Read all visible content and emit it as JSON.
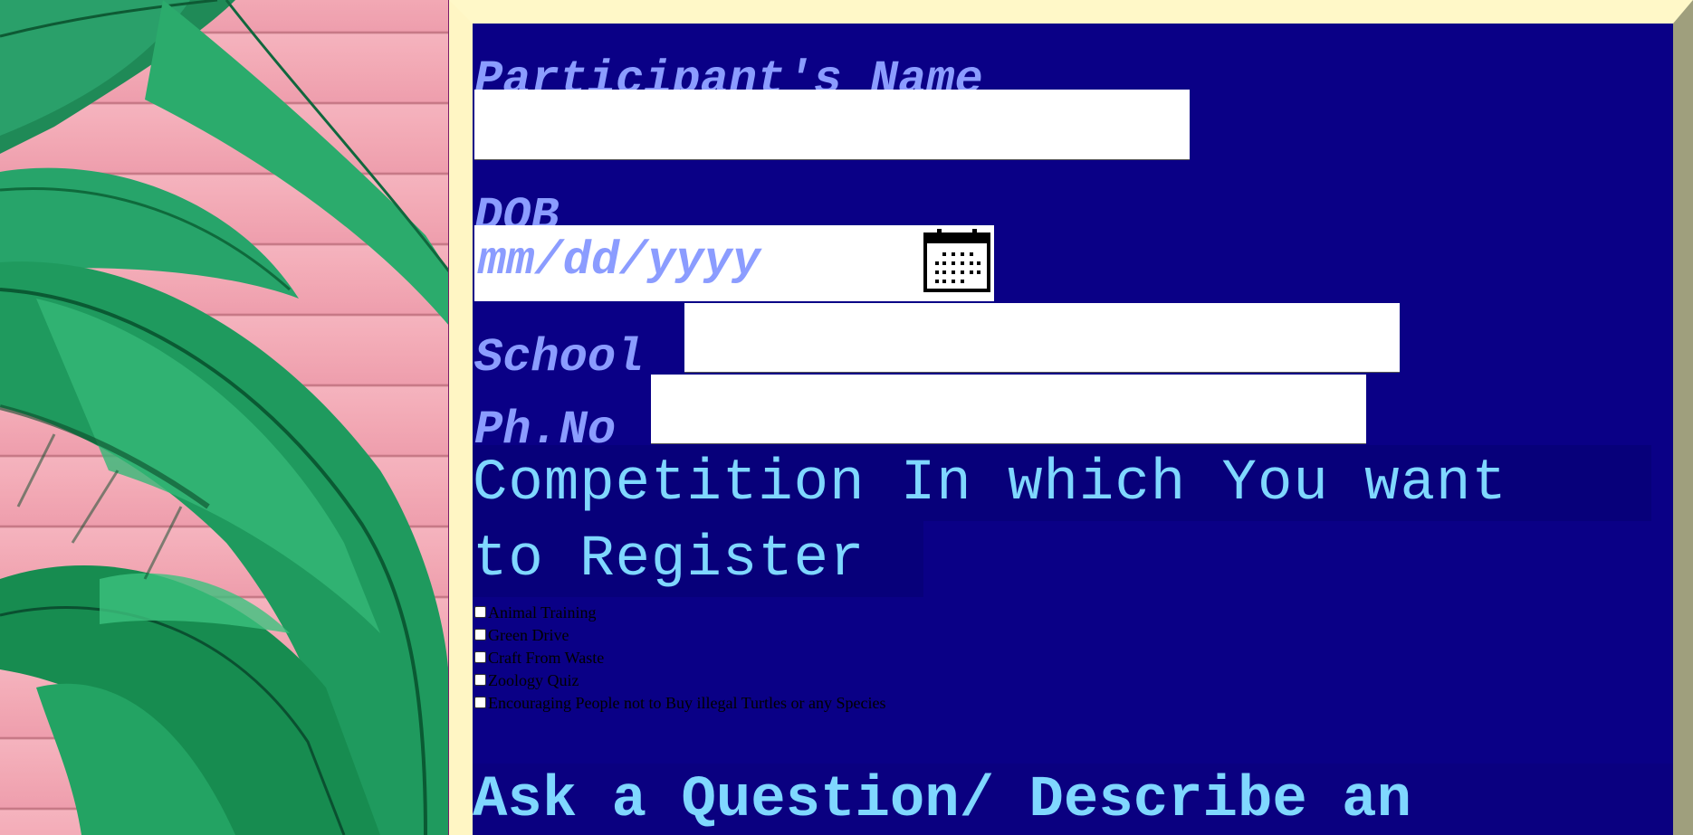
{
  "form": {
    "name_label": "Participant's Name",
    "name_value": "",
    "dob_label": "DOB",
    "dob_placeholder": "mm/dd/yyyy",
    "school_label": "School",
    "school_value": "",
    "phone_label": "Ph.No",
    "phone_value": "",
    "competition_heading_line1": "Competition In which You want",
    "competition_heading_line2": "to Register",
    "competitions": [
      {
        "label": "Animal Training",
        "checked": false
      },
      {
        "label": "Green Drive",
        "checked": false
      },
      {
        "label": "Craft From Waste",
        "checked": false
      },
      {
        "label": "Zoology Quiz",
        "checked": false
      },
      {
        "label": "Encouraging People not to Buy illegal Turtles or any Species",
        "checked": false
      }
    ],
    "ask_heading": "Ask a Question/ Describe an"
  },
  "colors": {
    "panel_bg": "#0a0086",
    "label_color": "#8b9cff",
    "heading_color": "#7fd7ff",
    "frame_light": "#fff8c8",
    "frame_dark": "#9f9f7d"
  },
  "icons": {
    "calendar": "calendar-icon"
  }
}
